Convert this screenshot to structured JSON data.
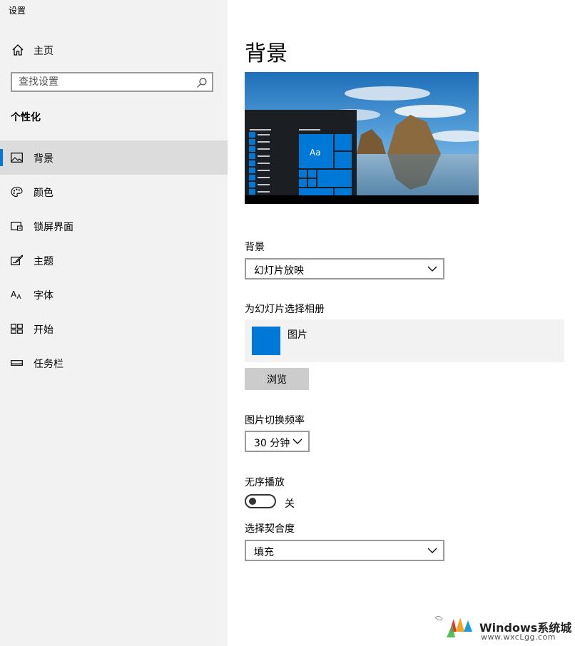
{
  "window": {
    "title": "设置"
  },
  "sidebar": {
    "home_label": "主页",
    "search_placeholder": "查找设置",
    "section_title": "个性化",
    "items": [
      {
        "label": "背景",
        "icon": "picture-icon",
        "selected": true
      },
      {
        "label": "颜色",
        "icon": "palette-icon",
        "selected": false
      },
      {
        "label": "锁屏界面",
        "icon": "lock-screen-icon",
        "selected": false
      },
      {
        "label": "主题",
        "icon": "theme-brush-icon",
        "selected": false
      },
      {
        "label": "字体",
        "icon": "font-icon",
        "selected": false
      },
      {
        "label": "开始",
        "icon": "start-icon",
        "selected": false
      },
      {
        "label": "任务栏",
        "icon": "taskbar-icon",
        "selected": false
      }
    ]
  },
  "main": {
    "title": "背景",
    "preview": {
      "tile_text": "Aa"
    },
    "background_label": "背景",
    "background_value": "幻灯片放映",
    "album_label": "为幻灯片选择相册",
    "album_name": "图片",
    "browse_label": "浏览",
    "interval_label": "图片切换频率",
    "interval_value": "30 分钟",
    "shuffle_label": "无序播放",
    "shuffle_state": "关",
    "fit_label": "选择契合度",
    "fit_value": "填充"
  },
  "watermark": {
    "text": "Windows系统城",
    "url": "www.wxcLgg.com"
  },
  "colors": {
    "accent": "#0078d7",
    "sidebar_bg": "#f2f2f2",
    "selected_bg": "#dcdcdc"
  }
}
